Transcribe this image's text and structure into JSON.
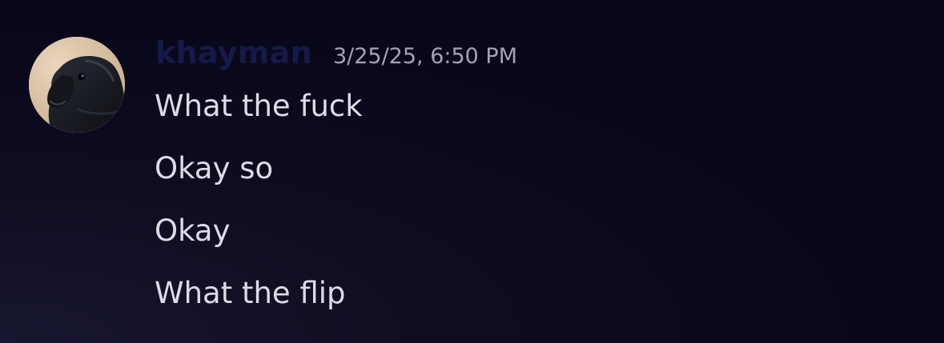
{
  "message": {
    "author": "khayman",
    "timestamp": "3/25/25, 6:50 PM",
    "avatar_icon": "raven-avatar",
    "lines": [
      "What the fuck",
      "Okay so",
      "Okay",
      "What the flip"
    ]
  },
  "colors": {
    "username": "#141b4a",
    "timestamp": "#a3a3b3",
    "text": "#dcdbe6",
    "background": "#09071a"
  }
}
